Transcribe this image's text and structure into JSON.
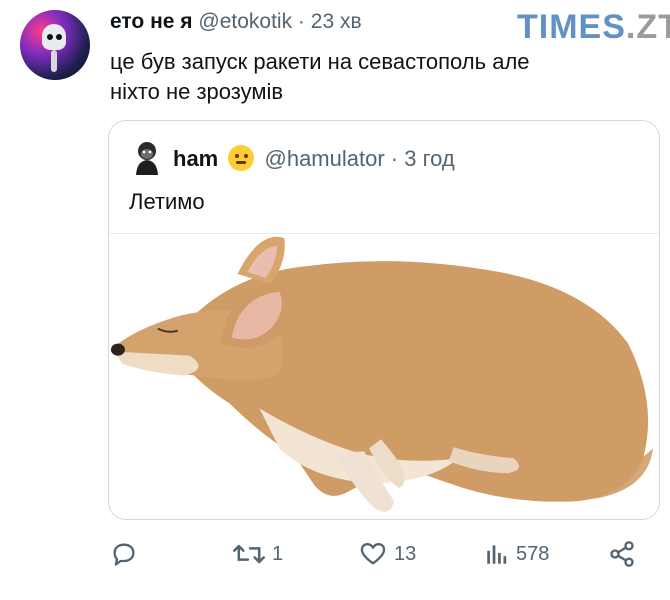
{
  "tweet": {
    "author_name": "ето не я",
    "handle": "@etokotik",
    "time": "23 хв",
    "text_line1": "це був запуск ракети на севастополь але",
    "text_line2": "ніхто не зрозумів"
  },
  "watermark": {
    "part1": "TIMES",
    "part2": ".ZT"
  },
  "quote": {
    "author_name": "ham",
    "emoji": "smiling-face-emoji",
    "handle": "@hamulator",
    "time": "3 год",
    "text": "Летимо",
    "media": "corgi-dog-photo"
  },
  "actions": {
    "retweets": "1",
    "likes": "13",
    "views": "578"
  },
  "colors": {
    "text": "#0f1419",
    "muted": "#536471",
    "border": "#cfd9de"
  }
}
